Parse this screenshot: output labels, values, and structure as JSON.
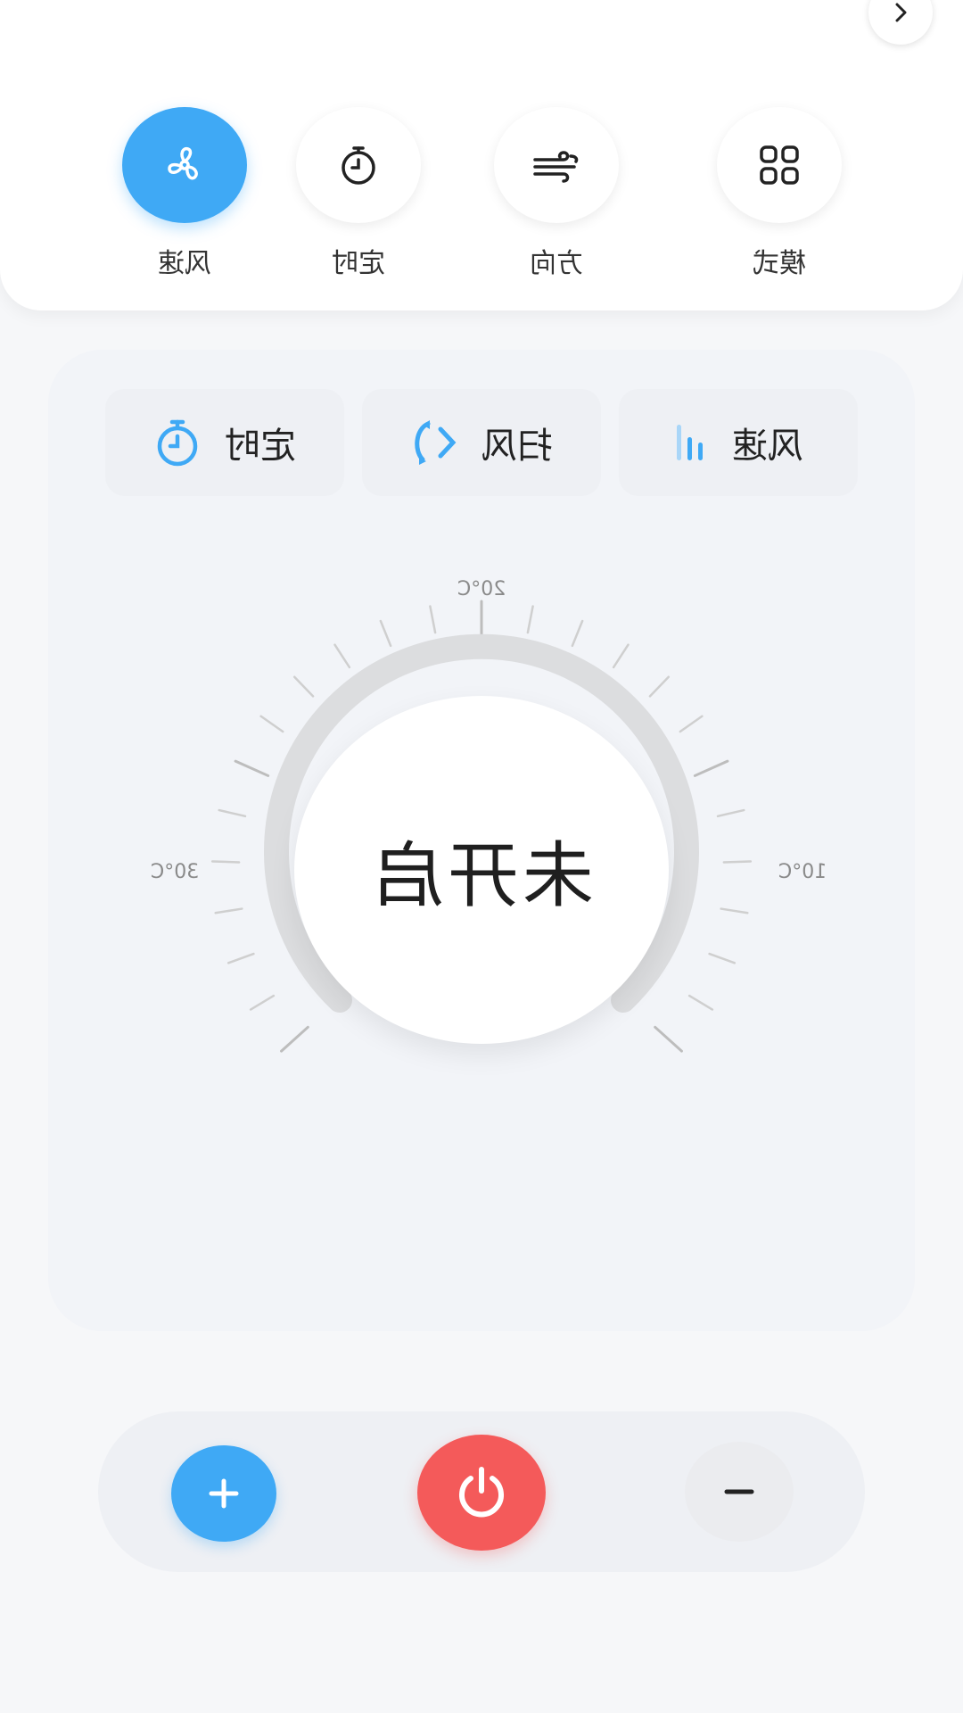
{
  "functions": [
    {
      "label": "风速",
      "icon": "fan-icon",
      "active": true
    },
    {
      "label": "定时",
      "icon": "timer-icon",
      "active": false
    },
    {
      "label": "方向",
      "icon": "wind-direction-icon",
      "active": false
    },
    {
      "label": "模式",
      "icon": "grid-mode-icon",
      "active": false
    }
  ],
  "chips": [
    {
      "label": "定时",
      "icon": "timer-icon"
    },
    {
      "label": "扫风",
      "icon": "swing-icon"
    },
    {
      "label": "风速",
      "icon": "speed-bars-icon"
    }
  ],
  "dial": {
    "status": "未开启",
    "label_top": "20°C",
    "label_left": "30°C",
    "label_right": "10°C"
  },
  "controls": {
    "plus_icon": "plus-icon",
    "power_icon": "power-icon",
    "minus_icon": "minus-icon"
  },
  "colors": {
    "accent": "#3fa9f5",
    "power": "#f45a5a",
    "background": "#f6f7f9"
  }
}
